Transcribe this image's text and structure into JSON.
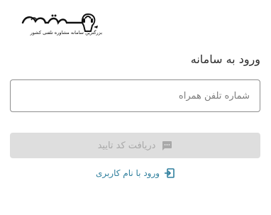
{
  "brand": {
    "logo_text": "همراه مشور",
    "tagline": "بزرگترین سامانه مشاوره تلفنی کشور"
  },
  "login": {
    "title": "ورود به سامانه",
    "phone_placeholder": "شماره تلفن همراه",
    "phone_value": "",
    "verify_button_label": "دریافت کد تایید",
    "username_link_label": "ورود با نام کاربری"
  },
  "icons": {
    "verify_button_icon": "chat-icon",
    "username_link_icon": "login-arrow-icon"
  },
  "colors": {
    "link": "#2f7f9d",
    "button_disabled_bg": "#dedede",
    "button_disabled_text": "#a8a8a8",
    "input_border": "#8e8e8e"
  }
}
